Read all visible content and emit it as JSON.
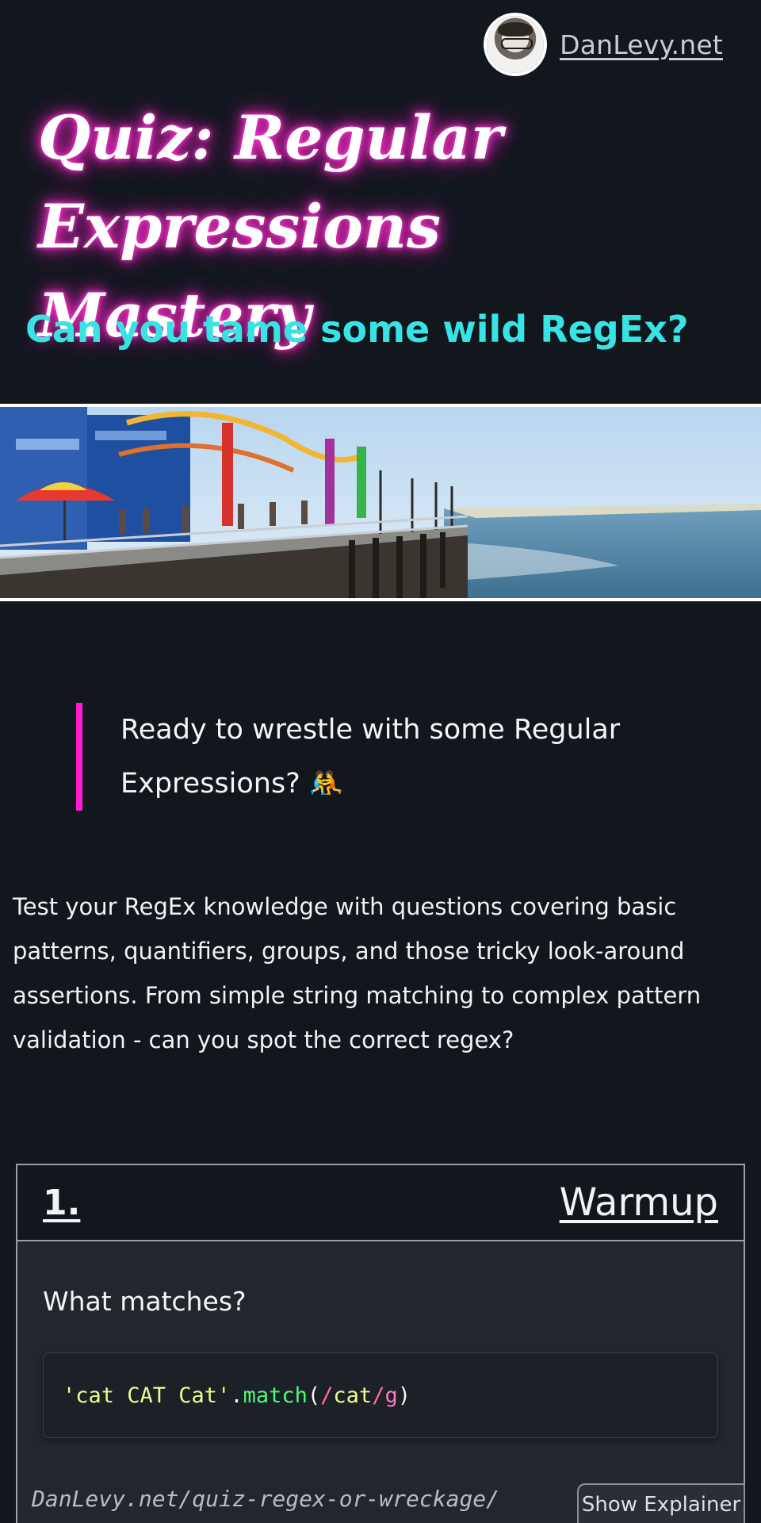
{
  "header": {
    "site_link": "DanLevy.net",
    "avatar_icon": "avatar-photo"
  },
  "hero": {
    "title": "Quiz: Regular Expressions Mastery",
    "subtitle": "Can you tame some wild RegEx?"
  },
  "banner": {
    "image": "santa-monica-pier-photo"
  },
  "quote": {
    "text": "Ready to wrestle with some Regular Expressions? 🤼"
  },
  "intro": {
    "text": "Test your RegEx knowledge with questions covering basic patterns, quantifiers, groups, and those tricky look-around assertions. From simple string matching to complex pattern validation - can you spot the correct regex?"
  },
  "quiz": {
    "number": "1.",
    "category": "Warmup",
    "prompt": "What matches?",
    "code": {
      "string": "'cat CAT Cat'",
      "dot": ".",
      "method": "match",
      "open": "(",
      "regex_open": "/",
      "regex_body": "cat",
      "regex_close": "/",
      "flag": "g",
      "close": ")"
    }
  },
  "footer": {
    "url": "DanLevy.net/quiz-regex-or-wreckage/",
    "explainer_button": "Show Explainer"
  },
  "colors": {
    "background": "#12171e",
    "neon_pink": "#ff1ccf",
    "cyan": "#37e3e3"
  }
}
